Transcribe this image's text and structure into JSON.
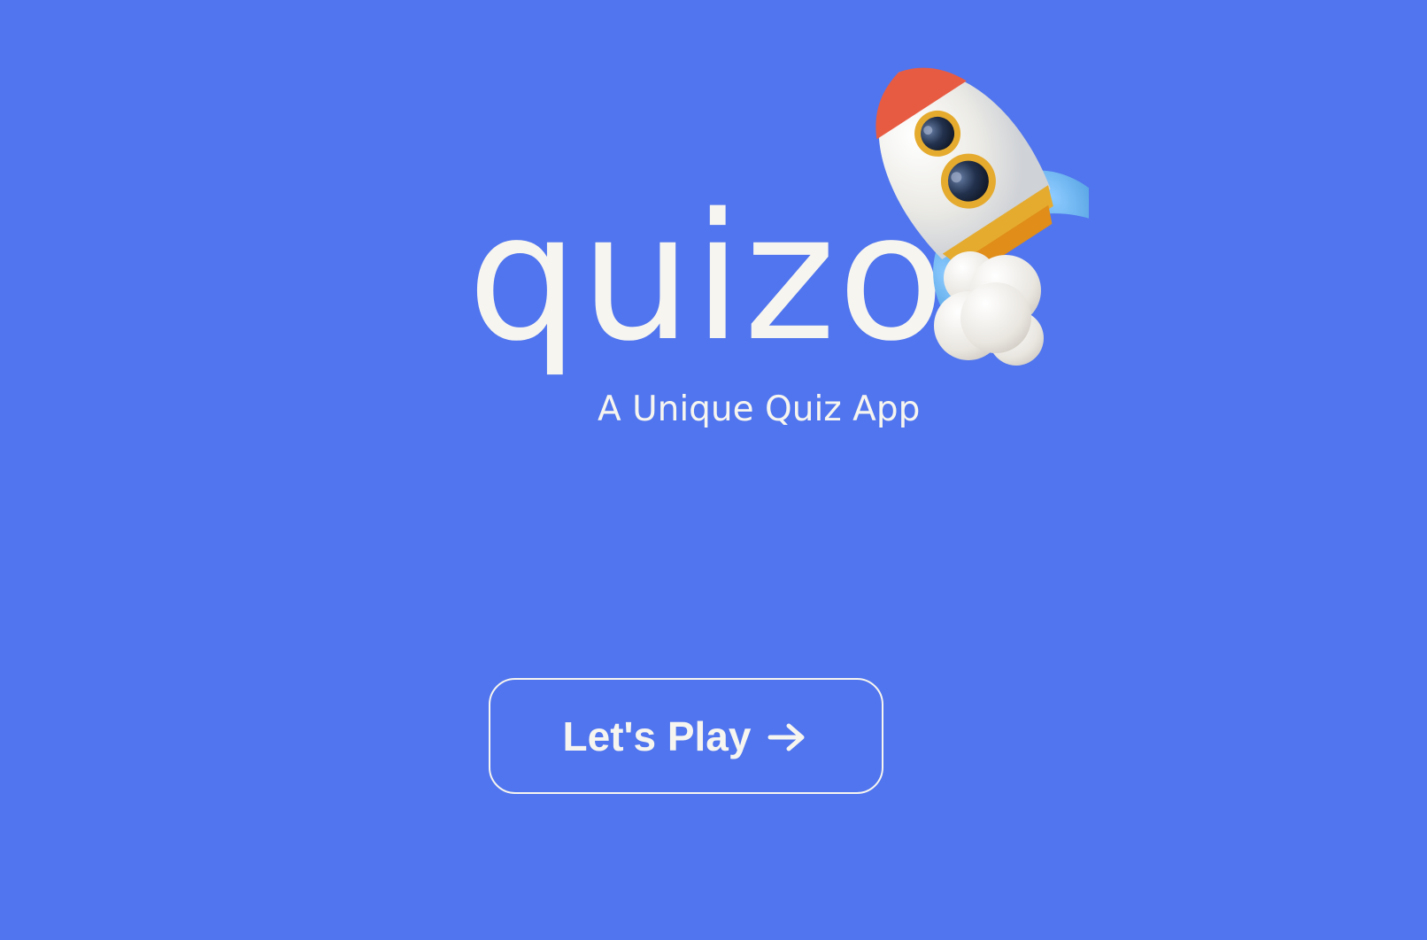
{
  "app": {
    "name": "quizo",
    "tagline": "A Unique Quiz App"
  },
  "hero": {
    "logo_icon": "rocket-icon"
  },
  "actions": {
    "play_label": "Let's Play",
    "play_icon": "arrow-right-icon"
  },
  "colors": {
    "background": "#5075ee",
    "text": "#f7f5f0",
    "rocket_body": "#f1f1ee",
    "rocket_fins": "#5ea9e7",
    "rocket_tip": "#e85b43",
    "rocket_gold": "#e5ab2f"
  }
}
